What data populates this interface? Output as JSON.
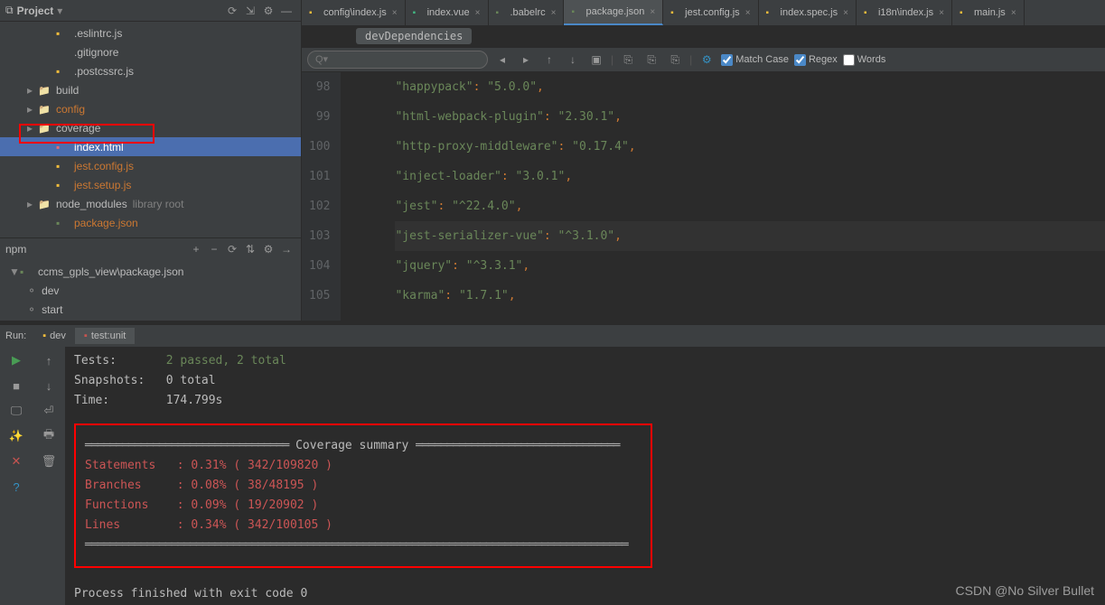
{
  "project": {
    "title": "Project",
    "tree": [
      {
        "name": ".eslintrc.js",
        "type": "js",
        "indent": 2
      },
      {
        "name": ".gitignore",
        "type": "file",
        "indent": 2
      },
      {
        "name": ".postcssrc.js",
        "type": "js",
        "indent": 2
      },
      {
        "name": "build",
        "type": "folder",
        "indent": 1,
        "arrow": true
      },
      {
        "name": "config",
        "type": "folder",
        "indent": 1,
        "arrow": true,
        "orange": true
      },
      {
        "name": "coverage",
        "type": "folder",
        "indent": 1,
        "arrow": true,
        "highlighted": true
      },
      {
        "name": "index.html",
        "type": "html",
        "indent": 2,
        "selected": true
      },
      {
        "name": "jest.config.js",
        "type": "js",
        "indent": 2,
        "orange": true
      },
      {
        "name": "jest.setup.js",
        "type": "js",
        "indent": 2,
        "orange": true
      },
      {
        "name": "node_modules",
        "type": "folder",
        "indent": 1,
        "arrow": true,
        "library": "library root"
      },
      {
        "name": "package.json",
        "type": "json",
        "indent": 2,
        "orange": true
      }
    ]
  },
  "npm": {
    "title": "npm",
    "root": "ccms_gpls_view\\package.json",
    "scripts": [
      "dev",
      "start"
    ]
  },
  "tabs": [
    {
      "label": "config\\index.js",
      "icon": "js"
    },
    {
      "label": "index.vue",
      "icon": "vue"
    },
    {
      "label": ".babelrc",
      "icon": "json"
    },
    {
      "label": "package.json",
      "icon": "json",
      "active": true
    },
    {
      "label": "jest.config.js",
      "icon": "js"
    },
    {
      "label": "index.spec.js",
      "icon": "js"
    },
    {
      "label": "i18n\\index.js",
      "icon": "js"
    },
    {
      "label": "main.js",
      "icon": "js"
    }
  ],
  "breadcrumb": "devDependencies",
  "search": {
    "placeholder": "Q▾",
    "matchCase": "Match Case",
    "regex": "Regex",
    "words": "Words"
  },
  "code": {
    "startLine": 98,
    "lines": [
      {
        "k": "happypack",
        "v": "5.0.0"
      },
      {
        "k": "html-webpack-plugin",
        "v": "2.30.1"
      },
      {
        "k": "http-proxy-middleware",
        "v": "0.17.4"
      },
      {
        "k": "inject-loader",
        "v": "3.0.1"
      },
      {
        "k": "jest",
        "v": "^22.4.0"
      },
      {
        "k": "jest-serializer-vue",
        "v": "^3.1.0",
        "hl": true
      },
      {
        "k": "jquery",
        "v": "^3.3.1"
      },
      {
        "k": "karma",
        "v": "1.7.1"
      }
    ]
  },
  "run": {
    "label": "Run:",
    "tabs": [
      "dev",
      "test:unit"
    ],
    "tests": {
      "label": "Tests:",
      "value": "2 passed, 2 total"
    },
    "snapshots": {
      "label": "Snapshots:",
      "value": "0 total"
    },
    "time": {
      "label": "Time:",
      "value": "174.799s"
    },
    "coverage": {
      "title": "Coverage summary",
      "rows": [
        {
          "name": "Statements",
          "pct": "0.31%",
          "frac": "342/109820"
        },
        {
          "name": "Branches",
          "pct": "0.08%",
          "frac": "38/48195"
        },
        {
          "name": "Functions",
          "pct": "0.09%",
          "frac": "19/20902"
        },
        {
          "name": "Lines",
          "pct": "0.34%",
          "frac": "342/100105"
        }
      ]
    },
    "exit": "Process finished with exit code 0"
  },
  "watermark": "CSDN @No Silver Bullet"
}
